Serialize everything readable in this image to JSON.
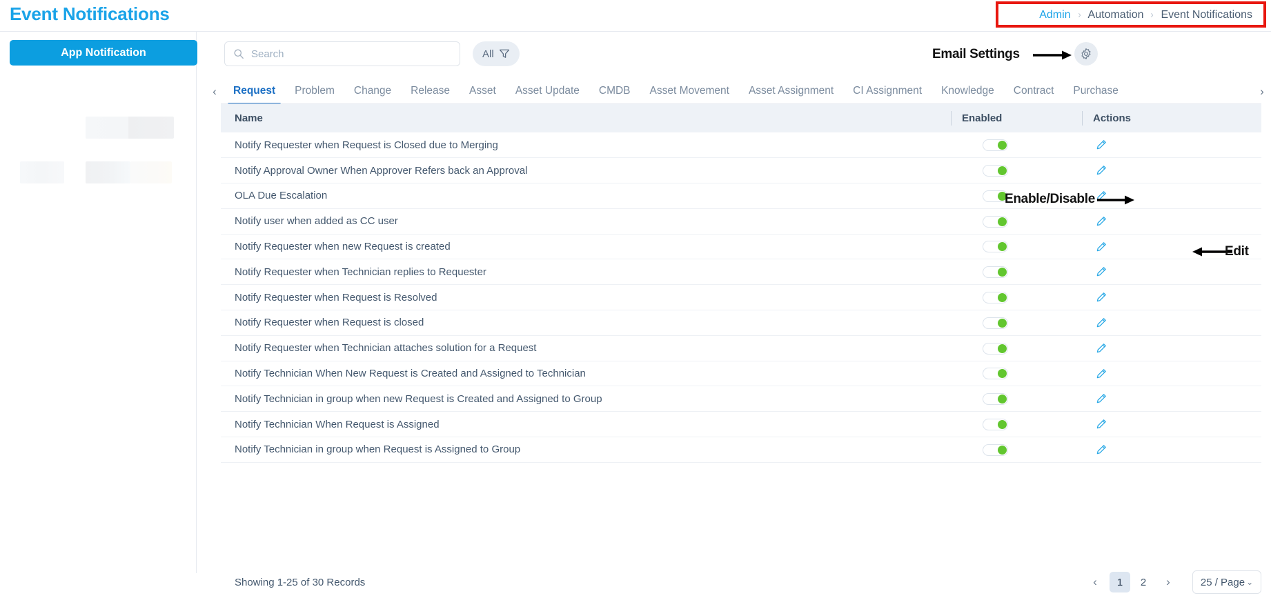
{
  "header": {
    "title": "Event Notifications",
    "breadcrumb": [
      {
        "label": "Admin",
        "is_link": true
      },
      {
        "label": "Automation",
        "is_link": false
      },
      {
        "label": "Event Notifications",
        "is_link": false
      }
    ],
    "breadcrumb_separator": "›",
    "highlight_color": "#e8170f"
  },
  "sidebar": {
    "app_notification_label": "App Notification",
    "active_color": "#0c9ee0"
  },
  "toolbar": {
    "search_placeholder": "Search",
    "search_value": "",
    "search_icon": "search-icon",
    "filter_label": "All",
    "filter_icon": "funnel-icon",
    "email_settings_label": "Email Settings",
    "gear_icon": "gear-icon"
  },
  "tabs": {
    "prev_icon": "‹",
    "next_icon": "›",
    "active": "Request",
    "items": [
      {
        "label": "Request"
      },
      {
        "label": "Problem"
      },
      {
        "label": "Change"
      },
      {
        "label": "Release"
      },
      {
        "label": "Asset"
      },
      {
        "label": "Asset Update"
      },
      {
        "label": "CMDB"
      },
      {
        "label": "Asset Movement"
      },
      {
        "label": "Asset Assignment"
      },
      {
        "label": "CI Assignment"
      },
      {
        "label": "Knowledge"
      },
      {
        "label": "Contract"
      },
      {
        "label": "Purchase"
      }
    ]
  },
  "table": {
    "columns": [
      "Name",
      "Enabled",
      "Actions"
    ],
    "rows": [
      {
        "name": "Notify Requester when Request is Closed due to Merging",
        "enabled": true
      },
      {
        "name": "Notify Approval Owner When Approver Refers back an Approval",
        "enabled": true
      },
      {
        "name": "OLA Due Escalation",
        "enabled": true
      },
      {
        "name": "Notify user when added as CC user",
        "enabled": true
      },
      {
        "name": "Notify Requester when new Request is created",
        "enabled": true
      },
      {
        "name": "Notify Requester when Technician replies to Requester",
        "enabled": true
      },
      {
        "name": "Notify Requester when Request is Resolved",
        "enabled": true
      },
      {
        "name": "Notify Requester when Request is closed",
        "enabled": true
      },
      {
        "name": "Notify Requester when Technician attaches solution for a Request",
        "enabled": true
      },
      {
        "name": "Notify Technician When New Request is Created and Assigned to Technician",
        "enabled": true
      },
      {
        "name": "Notify Technician in group when new Request is Created and Assigned to Group",
        "enabled": true
      },
      {
        "name": "Notify Technician When Request is Assigned",
        "enabled": true
      },
      {
        "name": "Notify Technician in group when Request is Assigned to Group",
        "enabled": true
      }
    ],
    "toggle_on_color": "#62c62f",
    "edit_icon": "pencil-icon"
  },
  "annotations": {
    "enable_disable": "Enable/Disable",
    "edit": "Edit"
  },
  "footer": {
    "records_text": "Showing 1-25 of 30 Records",
    "prev_icon": "‹",
    "next_icon": "›",
    "pages": [
      "1",
      "2"
    ],
    "active_page": "1",
    "page_size_label": "25 / Page",
    "caret_icon": "⌄"
  }
}
